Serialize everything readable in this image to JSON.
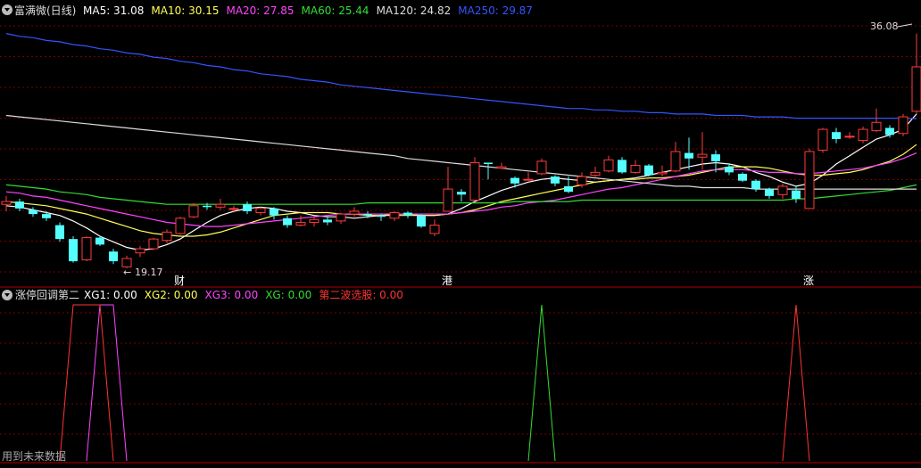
{
  "main_panel": {
    "stock_name": "富满微(日线)",
    "indicators": [
      {
        "label": "MA5: 31.08",
        "color": "#ffffff"
      },
      {
        "label": "MA10: 30.15",
        "color": "#ffff55"
      },
      {
        "label": "MA20: 27.85",
        "color": "#ff44ff"
      },
      {
        "label": "MA60: 25.44",
        "color": "#33dd33"
      },
      {
        "label": "MA120: 24.82",
        "color": "#dddddd"
      },
      {
        "label": "MA250: 29.87",
        "color": "#3355ff"
      }
    ],
    "high_label": "36.08",
    "low_label": "19.17",
    "markers": [
      {
        "text": "财",
        "index": 13
      },
      {
        "text": "港",
        "index": 33
      },
      {
        "text": "涨",
        "index": 60
      }
    ]
  },
  "sub_panel": {
    "title": "涨停回调第二",
    "indicators": [
      {
        "label": "XG1: 0.00",
        "color": "#ffffff"
      },
      {
        "label": "XG2: 0.00",
        "color": "#ffff55"
      },
      {
        "label": "XG3: 0.00",
        "color": "#ff44ff"
      },
      {
        "label": "XG: 0.00",
        "color": "#33dd33"
      },
      {
        "label": "第二波选股: 0.00",
        "color": "#ff3333"
      }
    ],
    "footer": "用到未来数据"
  },
  "colors": {
    "up": "#ff3b3b",
    "down": "#54ffff",
    "grid": "#7a0000",
    "border": "#a00000",
    "bg": "#000000"
  },
  "chart_data": {
    "type": "candlestick",
    "price_range": [
      18,
      37
    ],
    "candles": [
      [
        23.7,
        23.9,
        23.2,
        24.3
      ],
      [
        23.9,
        23.4,
        23.2,
        24.1
      ],
      [
        23.3,
        23.0,
        22.8,
        23.5
      ],
      [
        23.0,
        22.7,
        22.5,
        23.2
      ],
      [
        22.2,
        21.2,
        21.0,
        22.4
      ],
      [
        21.2,
        19.6,
        19.5,
        21.4
      ],
      [
        19.7,
        21.3,
        19.6,
        21.4
      ],
      [
        21.3,
        20.8,
        20.7,
        21.4
      ],
      [
        20.3,
        19.6,
        19.4,
        20.5
      ],
      [
        19.2,
        19.8,
        19.1,
        20.0
      ],
      [
        20.2,
        20.5,
        19.9,
        20.7
      ],
      [
        20.5,
        21.2,
        20.4,
        21.3
      ],
      [
        21.1,
        21.7,
        20.9,
        21.9
      ],
      [
        21.6,
        22.7,
        21.5,
        22.8
      ],
      [
        22.8,
        23.6,
        22.7,
        23.8
      ],
      [
        23.6,
        23.5,
        23.3,
        23.8
      ],
      [
        23.5,
        23.7,
        23.3,
        24.1
      ],
      [
        23.4,
        23.4,
        23.1,
        23.6
      ],
      [
        23.7,
        23.2,
        23.0,
        23.9
      ],
      [
        23.1,
        23.4,
        22.9,
        23.5
      ],
      [
        23.4,
        22.9,
        22.6,
        23.5
      ],
      [
        22.7,
        22.2,
        22.0,
        22.9
      ],
      [
        22.2,
        22.4,
        22.1,
        22.9
      ],
      [
        22.4,
        22.6,
        22.1,
        22.8
      ],
      [
        22.6,
        22.4,
        22.2,
        22.8
      ],
      [
        22.5,
        23.0,
        22.3,
        23.1
      ],
      [
        23.0,
        23.2,
        22.8,
        23.5
      ],
      [
        23.0,
        22.9,
        22.7,
        23.2
      ],
      [
        22.9,
        22.8,
        22.5,
        23.0
      ],
      [
        22.7,
        23.1,
        22.5,
        23.2
      ],
      [
        23.1,
        22.9,
        22.7,
        23.2
      ],
      [
        22.9,
        22.1,
        22.0,
        23.0
      ],
      [
        21.6,
        22.2,
        21.4,
        22.6
      ],
      [
        23.2,
        24.8,
        23.2,
        26.4
      ],
      [
        24.6,
        24.4,
        23.9,
        24.8
      ],
      [
        24.0,
        26.7,
        24.0,
        27.1
      ],
      [
        26.7,
        26.6,
        25.5,
        26.7
      ],
      [
        26.3,
        26.4,
        26.3,
        26.7
      ],
      [
        25.6,
        25.2,
        24.9,
        25.7
      ],
      [
        25.5,
        25.5,
        25.4,
        26.0
      ],
      [
        25.9,
        26.8,
        25.8,
        27.0
      ],
      [
        25.7,
        25.2,
        25.0,
        25.8
      ],
      [
        25.0,
        24.6,
        24.5,
        25.7
      ],
      [
        25.1,
        25.7,
        24.9,
        26.0
      ],
      [
        25.8,
        26.0,
        25.6,
        26.4
      ],
      [
        26.1,
        26.9,
        26.0,
        27.2
      ],
      [
        26.9,
        26.0,
        25.9,
        27.1
      ],
      [
        26.0,
        26.5,
        25.9,
        26.9
      ],
      [
        26.5,
        25.8,
        25.7,
        26.6
      ],
      [
        25.9,
        26.0,
        25.7,
        26.5
      ],
      [
        26.1,
        27.5,
        26.0,
        28.2
      ],
      [
        27.4,
        27.0,
        26.2,
        28.5
      ],
      [
        27.1,
        27.3,
        26.2,
        28.9
      ],
      [
        27.3,
        26.8,
        26.0,
        27.6
      ],
      [
        26.4,
        26.0,
        25.8,
        26.6
      ],
      [
        25.9,
        25.4,
        25.3,
        26.0
      ],
      [
        25.4,
        24.8,
        24.6,
        25.5
      ],
      [
        24.8,
        24.3,
        24.1,
        24.9
      ],
      [
        24.4,
        25.0,
        24.1,
        25.2
      ],
      [
        24.7,
        24.1,
        23.8,
        25.0
      ],
      [
        23.4,
        27.5,
        23.4,
        27.7
      ],
      [
        27.6,
        29.1,
        27.4,
        29.2
      ],
      [
        28.9,
        28.4,
        28.1,
        29.2
      ],
      [
        28.6,
        28.6,
        28.4,
        28.9
      ],
      [
        28.3,
        29.1,
        28.1,
        29.3
      ],
      [
        29.0,
        29.6,
        28.9,
        30.6
      ],
      [
        29.2,
        28.7,
        28.5,
        29.4
      ],
      [
        28.8,
        30.0,
        28.6,
        30.2
      ],
      [
        30.4,
        33.6,
        30.2,
        36.0
      ]
    ],
    "ma_series": [
      {
        "name": "MA5",
        "values": [
          23.6,
          23.5,
          23.3,
          23.1,
          22.9,
          22.5,
          22.0,
          21.4,
          21.0,
          20.6,
          20.4,
          20.5,
          20.8,
          21.2,
          21.8,
          22.4,
          22.9,
          23.2,
          23.4,
          23.5,
          23.4,
          23.2,
          23.1,
          22.9,
          22.8,
          22.8,
          22.7,
          22.8,
          22.9,
          23.0,
          23.0,
          22.9,
          22.9,
          23.0,
          23.4,
          23.9,
          24.3,
          24.7,
          25.0,
          25.3,
          25.5,
          25.6,
          25.5,
          25.4,
          25.3,
          25.4,
          25.5,
          25.6,
          25.8,
          26.0,
          26.2,
          26.4,
          26.6,
          26.7,
          26.6,
          26.4,
          26.0,
          25.7,
          25.3,
          25.0,
          25.2,
          25.8,
          26.6,
          27.2,
          27.8,
          28.4,
          28.7,
          29.1,
          30.2
        ]
      },
      {
        "name": "MA10",
        "values": [
          23.9,
          23.8,
          23.7,
          23.6,
          23.4,
          23.2,
          23.0,
          22.7,
          22.4,
          22.1,
          21.8,
          21.6,
          21.5,
          21.4,
          21.4,
          21.5,
          21.7,
          22.0,
          22.3,
          22.6,
          22.9,
          23.0,
          23.1,
          23.1,
          23.1,
          23.0,
          23.0,
          22.9,
          22.9,
          22.9,
          22.9,
          22.9,
          22.9,
          23.0,
          23.1,
          23.3,
          23.6,
          23.9,
          24.1,
          24.3,
          24.5,
          24.7,
          24.9,
          25.1,
          25.3,
          25.4,
          25.5,
          25.5,
          25.6,
          25.6,
          25.7,
          25.8,
          26.0,
          26.2,
          26.4,
          26.4,
          26.4,
          26.3,
          26.1,
          25.9,
          25.8,
          25.8,
          25.9,
          26.0,
          26.2,
          26.5,
          26.8,
          27.3,
          28.0
        ]
      },
      {
        "name": "MA20",
        "values": [
          24.6,
          24.5,
          24.3,
          24.2,
          24.0,
          23.8,
          23.6,
          23.4,
          23.2,
          23.0,
          22.8,
          22.6,
          22.4,
          22.3,
          22.2,
          22.1,
          22.1,
          22.2,
          22.3,
          22.4,
          22.5,
          22.6,
          22.7,
          22.8,
          22.9,
          23.0,
          23.0,
          23.0,
          23.0,
          23.0,
          23.0,
          23.0,
          23.0,
          23.0,
          23.1,
          23.2,
          23.3,
          23.5,
          23.6,
          23.8,
          23.9,
          24.0,
          24.2,
          24.4,
          24.6,
          24.8,
          24.9,
          25.1,
          25.3,
          25.5,
          25.7,
          25.9,
          26.1,
          26.2,
          26.2,
          26.2,
          26.1,
          26.0,
          26.0,
          25.9,
          25.9,
          26.0,
          26.1,
          26.2,
          26.3,
          26.5,
          26.7,
          27.0,
          27.4
        ]
      },
      {
        "name": "MA60",
        "values": [
          25.1,
          25.0,
          24.9,
          24.8,
          24.6,
          24.5,
          24.4,
          24.2,
          24.1,
          24.0,
          23.9,
          23.8,
          23.7,
          23.7,
          23.7,
          23.7,
          23.7,
          23.7,
          23.7,
          23.7,
          23.7,
          23.7,
          23.7,
          23.7,
          23.7,
          23.7,
          23.7,
          23.8,
          23.8,
          23.8,
          23.8,
          23.8,
          23.8,
          23.8,
          23.8,
          23.8,
          23.8,
          23.8,
          23.9,
          23.9,
          23.9,
          23.9,
          23.9,
          24.0,
          24.0,
          24.0,
          24.0,
          24.0,
          24.0,
          24.0,
          24.0,
          24.0,
          24.0,
          24.0,
          24.0,
          24.0,
          24.0,
          24.0,
          24.0,
          24.1,
          24.1,
          24.2,
          24.3,
          24.4,
          24.5,
          24.6,
          24.7,
          24.9,
          25.1
        ]
      },
      {
        "name": "MA120",
        "values": [
          30.1,
          30.0,
          29.9,
          29.8,
          29.7,
          29.6,
          29.5,
          29.4,
          29.3,
          29.2,
          29.1,
          29.0,
          28.9,
          28.8,
          28.7,
          28.6,
          28.5,
          28.4,
          28.3,
          28.2,
          28.1,
          28.0,
          27.9,
          27.8,
          27.7,
          27.6,
          27.5,
          27.4,
          27.3,
          27.2,
          27.0,
          26.9,
          26.8,
          26.7,
          26.6,
          26.5,
          26.4,
          26.3,
          26.2,
          26.1,
          26.0,
          25.9,
          25.8,
          25.7,
          25.6,
          25.5,
          25.4,
          25.3,
          25.2,
          25.1,
          25.0,
          25.0,
          24.9,
          24.9,
          24.9,
          24.9,
          24.8,
          24.8,
          24.8,
          24.8,
          24.8,
          24.8,
          24.8,
          24.8,
          24.8,
          24.8,
          24.8,
          24.8,
          24.8
        ]
      },
      {
        "name": "MA250",
        "values": [
          36.0,
          35.8,
          35.7,
          35.5,
          35.4,
          35.2,
          35.1,
          34.9,
          34.8,
          34.6,
          34.5,
          34.3,
          34.2,
          34.0,
          33.9,
          33.7,
          33.6,
          33.4,
          33.3,
          33.1,
          33.0,
          32.9,
          32.7,
          32.6,
          32.5,
          32.3,
          32.2,
          32.1,
          32.0,
          31.9,
          31.8,
          31.7,
          31.6,
          31.5,
          31.4,
          31.3,
          31.2,
          31.1,
          31.0,
          30.9,
          30.8,
          30.7,
          30.6,
          30.6,
          30.5,
          30.5,
          30.4,
          30.4,
          30.3,
          30.3,
          30.2,
          30.2,
          30.2,
          30.1,
          30.1,
          30.1,
          30.0,
          30.0,
          30.0,
          29.9,
          29.9,
          29.9,
          29.9,
          29.9,
          29.9,
          29.9,
          29.9,
          29.9,
          29.87
        ]
      }
    ],
    "signals": [
      {
        "name": "XG1",
        "color": "#ffffff",
        "values": []
      },
      {
        "name": "XG2",
        "color": "#ffff55",
        "values": []
      },
      {
        "name": "XG3",
        "color": "#ff44ff",
        "values": [
          [
            7,
            1
          ],
          [
            8,
            1
          ]
        ]
      },
      {
        "name": "XG",
        "color": "#33dd33",
        "values": [
          [
            40,
            1
          ]
        ]
      },
      {
        "name": "第二波选股",
        "color": "#ff3333",
        "values": [
          [
            5,
            1
          ],
          [
            6,
            1
          ],
          [
            7,
            1
          ],
          [
            59,
            1
          ]
        ]
      }
    ],
    "signal_range": [
      0,
      1
    ]
  }
}
